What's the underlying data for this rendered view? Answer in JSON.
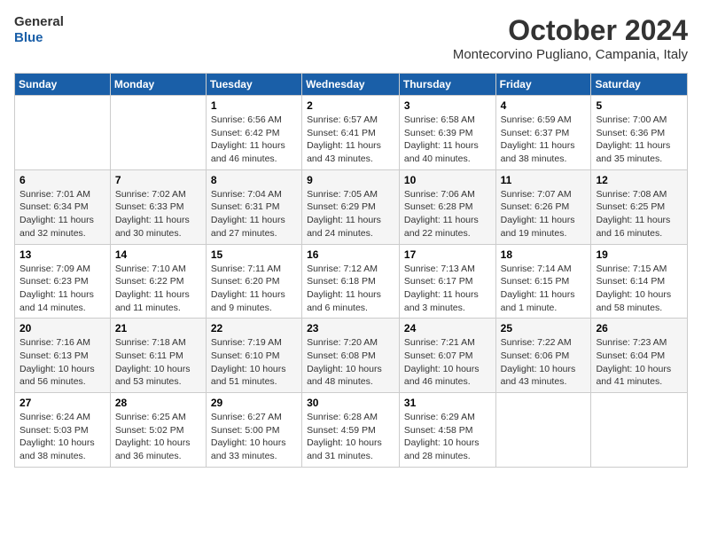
{
  "logo": {
    "line1": "General",
    "line2": "Blue"
  },
  "title": "October 2024",
  "subtitle": "Montecorvino Pugliano, Campania, Italy",
  "weekdays": [
    "Sunday",
    "Monday",
    "Tuesday",
    "Wednesday",
    "Thursday",
    "Friday",
    "Saturday"
  ],
  "weeks": [
    [
      {
        "num": "",
        "info": ""
      },
      {
        "num": "",
        "info": ""
      },
      {
        "num": "1",
        "info": "Sunrise: 6:56 AM\nSunset: 6:42 PM\nDaylight: 11 hours and 46 minutes."
      },
      {
        "num": "2",
        "info": "Sunrise: 6:57 AM\nSunset: 6:41 PM\nDaylight: 11 hours and 43 minutes."
      },
      {
        "num": "3",
        "info": "Sunrise: 6:58 AM\nSunset: 6:39 PM\nDaylight: 11 hours and 40 minutes."
      },
      {
        "num": "4",
        "info": "Sunrise: 6:59 AM\nSunset: 6:37 PM\nDaylight: 11 hours and 38 minutes."
      },
      {
        "num": "5",
        "info": "Sunrise: 7:00 AM\nSunset: 6:36 PM\nDaylight: 11 hours and 35 minutes."
      }
    ],
    [
      {
        "num": "6",
        "info": "Sunrise: 7:01 AM\nSunset: 6:34 PM\nDaylight: 11 hours and 32 minutes."
      },
      {
        "num": "7",
        "info": "Sunrise: 7:02 AM\nSunset: 6:33 PM\nDaylight: 11 hours and 30 minutes."
      },
      {
        "num": "8",
        "info": "Sunrise: 7:04 AM\nSunset: 6:31 PM\nDaylight: 11 hours and 27 minutes."
      },
      {
        "num": "9",
        "info": "Sunrise: 7:05 AM\nSunset: 6:29 PM\nDaylight: 11 hours and 24 minutes."
      },
      {
        "num": "10",
        "info": "Sunrise: 7:06 AM\nSunset: 6:28 PM\nDaylight: 11 hours and 22 minutes."
      },
      {
        "num": "11",
        "info": "Sunrise: 7:07 AM\nSunset: 6:26 PM\nDaylight: 11 hours and 19 minutes."
      },
      {
        "num": "12",
        "info": "Sunrise: 7:08 AM\nSunset: 6:25 PM\nDaylight: 11 hours and 16 minutes."
      }
    ],
    [
      {
        "num": "13",
        "info": "Sunrise: 7:09 AM\nSunset: 6:23 PM\nDaylight: 11 hours and 14 minutes."
      },
      {
        "num": "14",
        "info": "Sunrise: 7:10 AM\nSunset: 6:22 PM\nDaylight: 11 hours and 11 minutes."
      },
      {
        "num": "15",
        "info": "Sunrise: 7:11 AM\nSunset: 6:20 PM\nDaylight: 11 hours and 9 minutes."
      },
      {
        "num": "16",
        "info": "Sunrise: 7:12 AM\nSunset: 6:18 PM\nDaylight: 11 hours and 6 minutes."
      },
      {
        "num": "17",
        "info": "Sunrise: 7:13 AM\nSunset: 6:17 PM\nDaylight: 11 hours and 3 minutes."
      },
      {
        "num": "18",
        "info": "Sunrise: 7:14 AM\nSunset: 6:15 PM\nDaylight: 11 hours and 1 minute."
      },
      {
        "num": "19",
        "info": "Sunrise: 7:15 AM\nSunset: 6:14 PM\nDaylight: 10 hours and 58 minutes."
      }
    ],
    [
      {
        "num": "20",
        "info": "Sunrise: 7:16 AM\nSunset: 6:13 PM\nDaylight: 10 hours and 56 minutes."
      },
      {
        "num": "21",
        "info": "Sunrise: 7:18 AM\nSunset: 6:11 PM\nDaylight: 10 hours and 53 minutes."
      },
      {
        "num": "22",
        "info": "Sunrise: 7:19 AM\nSunset: 6:10 PM\nDaylight: 10 hours and 51 minutes."
      },
      {
        "num": "23",
        "info": "Sunrise: 7:20 AM\nSunset: 6:08 PM\nDaylight: 10 hours and 48 minutes."
      },
      {
        "num": "24",
        "info": "Sunrise: 7:21 AM\nSunset: 6:07 PM\nDaylight: 10 hours and 46 minutes."
      },
      {
        "num": "25",
        "info": "Sunrise: 7:22 AM\nSunset: 6:06 PM\nDaylight: 10 hours and 43 minutes."
      },
      {
        "num": "26",
        "info": "Sunrise: 7:23 AM\nSunset: 6:04 PM\nDaylight: 10 hours and 41 minutes."
      }
    ],
    [
      {
        "num": "27",
        "info": "Sunrise: 6:24 AM\nSunset: 5:03 PM\nDaylight: 10 hours and 38 minutes."
      },
      {
        "num": "28",
        "info": "Sunrise: 6:25 AM\nSunset: 5:02 PM\nDaylight: 10 hours and 36 minutes."
      },
      {
        "num": "29",
        "info": "Sunrise: 6:27 AM\nSunset: 5:00 PM\nDaylight: 10 hours and 33 minutes."
      },
      {
        "num": "30",
        "info": "Sunrise: 6:28 AM\nSunset: 4:59 PM\nDaylight: 10 hours and 31 minutes."
      },
      {
        "num": "31",
        "info": "Sunrise: 6:29 AM\nSunset: 4:58 PM\nDaylight: 10 hours and 28 minutes."
      },
      {
        "num": "",
        "info": ""
      },
      {
        "num": "",
        "info": ""
      }
    ]
  ]
}
